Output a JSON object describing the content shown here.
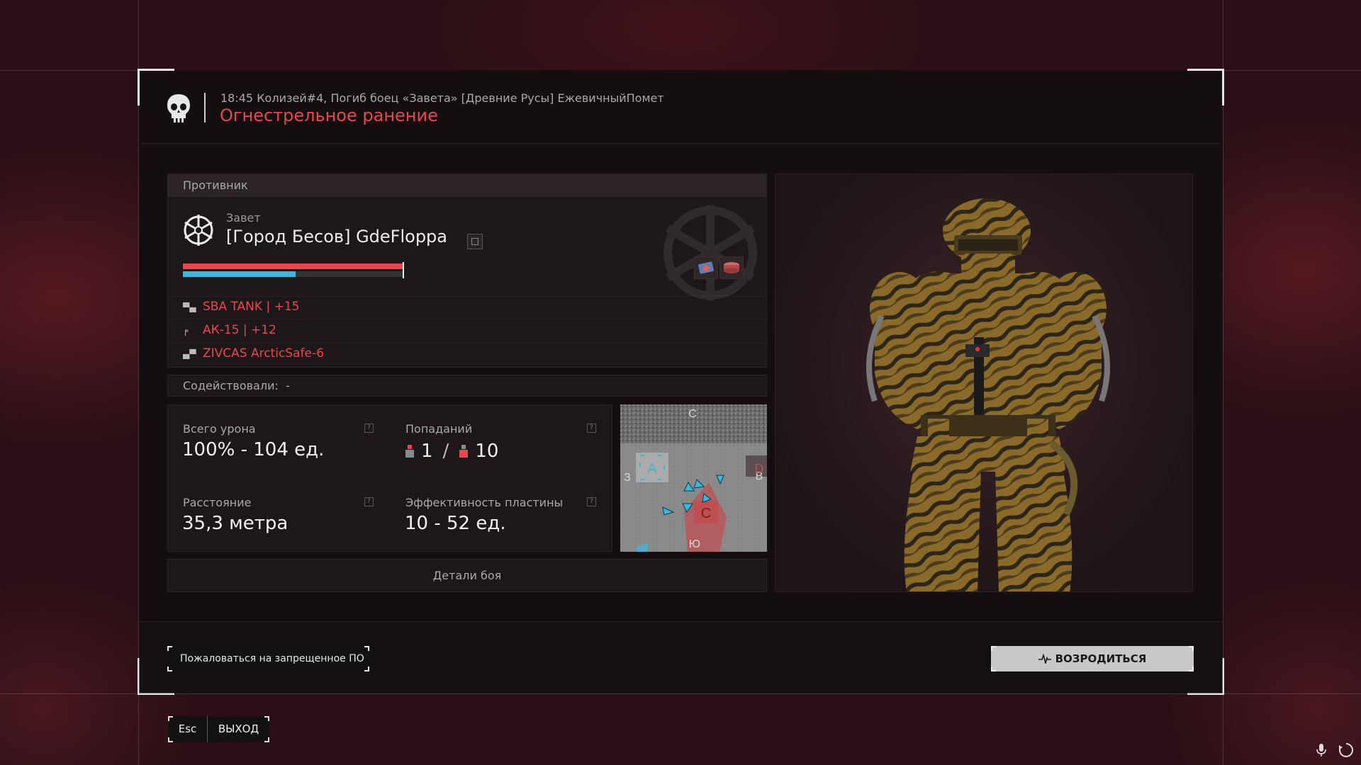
{
  "header": {
    "event": "18:45 Колизей#4, Погиб боец «Завета» [Древние Русы] ЕжевичныйПомет",
    "cause": "Огнестрельное ранение"
  },
  "enemy": {
    "section_title": "Противник",
    "faction": "Завет",
    "name": "[Город Бесов] GdeFloppa",
    "health_fraction": 1.0,
    "armor_fraction": 0.51,
    "equipment": [
      {
        "icon": "armor-icon",
        "label": "SBA TANK | +15"
      },
      {
        "icon": "rifle-icon",
        "label": "АК-15 | +12"
      },
      {
        "icon": "helmet-icon",
        "label": "ZIVCAS ArcticSafe-6"
      }
    ]
  },
  "assist": {
    "label": "Содействовали:",
    "value": "-"
  },
  "stats": {
    "total_damage_label": "Всего урона",
    "total_damage_value": "100% - 104 ед.",
    "hits_label": "Попаданий",
    "hits_head": "1",
    "hits_body": "10",
    "distance_label": "Расстояние",
    "distance_value": "35,3 метра",
    "plate_label": "Эффективность пластины",
    "plate_value": "10 - 52 ед.",
    "help_glyph": "?"
  },
  "minimap": {
    "north": "С",
    "south": "Ю",
    "west": "З",
    "east": "В",
    "point_a": "A",
    "point_c": "C",
    "point_d": "D"
  },
  "details_button": "Детали боя",
  "footer": {
    "report_button": "Пожаловаться на запрещенное ПО",
    "respawn_button": "ВОЗРОДИТЬСЯ"
  },
  "exit": {
    "key": "Esc",
    "label": "ВЫХОД"
  },
  "colors": {
    "accent_red": "#e8474f",
    "armor_blue": "#3fb6d8",
    "panel_bg": "#1d171a"
  }
}
